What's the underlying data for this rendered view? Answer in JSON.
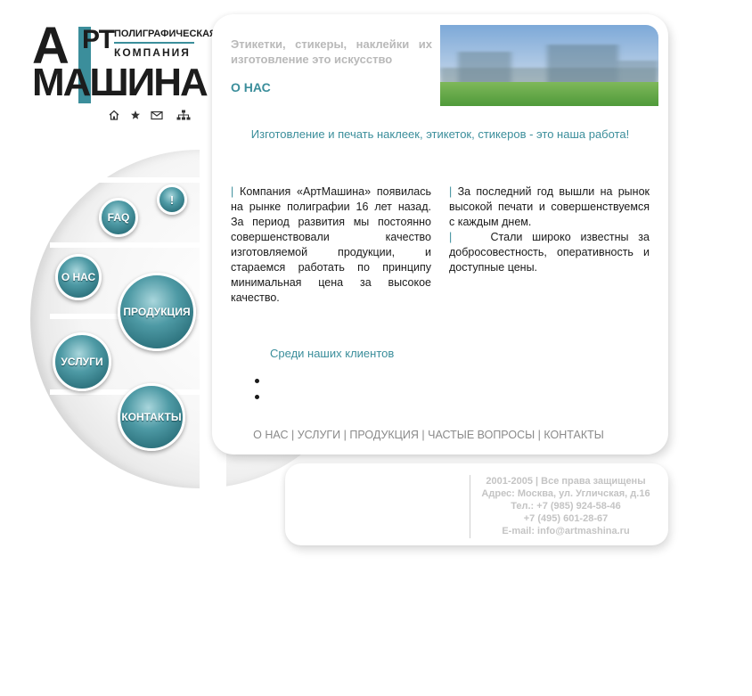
{
  "logo": {
    "line1": "ПОЛИГРАФИЧЕСКАЯ",
    "line2": "КОМПАНИЯ",
    "word_top_a": "А",
    "word_top_rt": "РТ",
    "word_bottom": "МАШИНА"
  },
  "quick_icons": [
    "home-icon",
    "star-icon",
    "mail-icon",
    "sitemap-icon"
  ],
  "left_nav": {
    "items": [
      {
        "label": "!",
        "name": "nav-ball-news"
      },
      {
        "label": "FAQ",
        "name": "nav-ball-faq"
      },
      {
        "label": "О НАС",
        "name": "nav-ball-about"
      },
      {
        "label": "ПРОДУКЦИЯ",
        "name": "nav-ball-products"
      },
      {
        "label": "УСЛУГИ",
        "name": "nav-ball-services"
      },
      {
        "label": "КОНТАКТЫ",
        "name": "nav-ball-contacts"
      }
    ]
  },
  "header": {
    "tagline": "Этикетки, стикеры, наклейки их изготовление это искусство",
    "page_title": "О НАС"
  },
  "main": {
    "slogan": "Изготовление и печать наклеек, этикеток, стикеров - это наша работа!",
    "col_left": "Компания «АртМашина» появилась на рынке полиграфии 16 лет назад. За период развития мы постоянно совершенствовали качество изготовляемой продукции, и стараемся работать по принципу минимальная цена за высокое качество.",
    "col_right_1": "За последний год вышли на рынок высокой печати и совершенствуемся с каждым днем.",
    "col_right_2": "Стали широко известны за добросовестность, оперативность и доступные цены.",
    "clients_heading": "Среди наших клиентов",
    "pipe": "|"
  },
  "footer_nav": {
    "items": [
      "О НАС",
      "УСЛУГИ",
      "ПРОДУКЦИЯ",
      "ЧАСТЫЕ ВОПРОСЫ",
      "КОНТАКТЫ"
    ],
    "separator": " | "
  },
  "footer_info": {
    "copyright": "2001-2005 | Все права защищены",
    "address": "Адрес: Москва, ул. Угличская, д.16",
    "phone1": "Тел.: +7 (985) 924-58-46",
    "phone2": "+7 (495) 601-28-67",
    "email": "E-mail: info@artmashina.ru"
  },
  "colors": {
    "accent": "#3b8e9b",
    "muted_text": "#b9b9b9",
    "body_text": "#1a1a1a"
  }
}
